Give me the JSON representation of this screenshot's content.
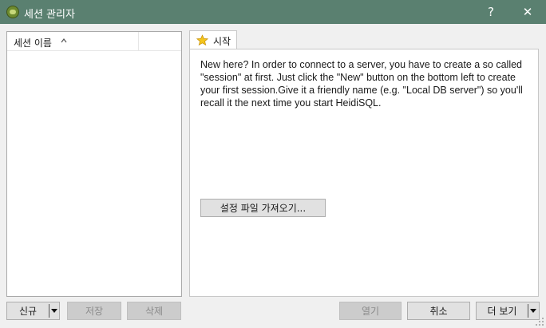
{
  "window": {
    "title": "세션 관리자",
    "help_label": "?",
    "close_label": "✕"
  },
  "session_list": {
    "column_header": "세션 이름"
  },
  "tabs": [
    {
      "label": "시작",
      "icon": "star-icon"
    }
  ],
  "start_tab": {
    "welcome_text": "New here? In order to connect to a server, you have to create a so called \"session\" at first. Just click the \"New\" button on the bottom left to create your first session.Give it a friendly name (e.g. \"Local DB server\") so you'll recall it the next time you start HeidiSQL.",
    "import_button_label": "설정 파일 가져오기..."
  },
  "bottom_buttons": {
    "new_label": "신규",
    "save_label": "저장",
    "delete_label": "삭제",
    "open_label": "열기",
    "cancel_label": "취소",
    "more_label": "더 보기"
  },
  "colors": {
    "titlebar": "#5a8070",
    "background": "#f0f0f0",
    "button_face": "#e1e1e1",
    "disabled_text": "#8a8a8a"
  }
}
